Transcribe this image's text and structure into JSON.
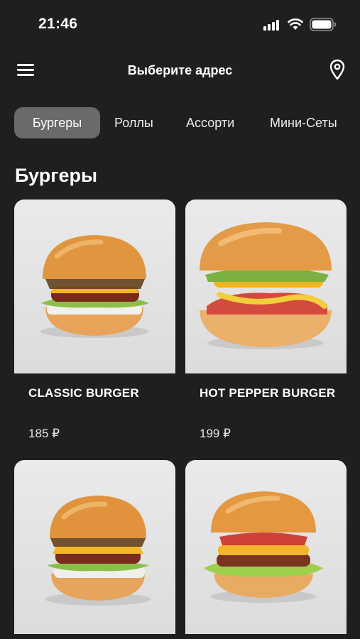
{
  "status_bar": {
    "time": "21:46"
  },
  "header": {
    "title": "Выберите адрес",
    "menu_icon": "hamburger-menu-icon",
    "location_icon": "map-pin-icon"
  },
  "categories": [
    {
      "label": "Бургеры",
      "active": true
    },
    {
      "label": "Роллы",
      "active": false
    },
    {
      "label": "Ассорти",
      "active": false
    },
    {
      "label": "Мини-Сеты",
      "active": false
    }
  ],
  "section": {
    "title": "Бургеры"
  },
  "products": [
    {
      "name": "CLASSIC BURGER",
      "price": "185 ₽"
    },
    {
      "name": "HOT PEPPER BURGER",
      "price": "199 ₽"
    },
    {
      "name": "",
      "price": ""
    },
    {
      "name": "",
      "price": ""
    }
  ],
  "colors": {
    "background": "#1f1f20",
    "active_chip": "#6a6a6c",
    "text": "#ffffff"
  }
}
